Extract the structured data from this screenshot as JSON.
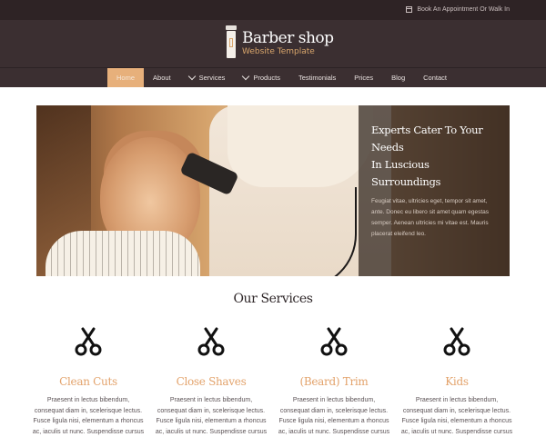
{
  "topbar": {
    "appointment": "Book An Appointment Or Walk In",
    "icon": "calendar-icon"
  },
  "brand": {
    "title": "Barber shop",
    "subtitle": "Website Template",
    "icon": "razor-logo-icon",
    "accent": "#d9a66c"
  },
  "nav": {
    "items": [
      {
        "label": "Home",
        "active": true
      },
      {
        "label": "About"
      },
      {
        "label": "Services",
        "dropdown": true
      },
      {
        "label": "Products",
        "dropdown": true
      },
      {
        "label": "Testimonials"
      },
      {
        "label": "Prices"
      },
      {
        "label": "Blog"
      },
      {
        "label": "Contact"
      }
    ],
    "active_color": "#e7b07b"
  },
  "hero": {
    "heading_line1": "Experts Cater To Your Needs",
    "heading_line2": "In Luscious Surroundings",
    "text": "Feugiat vitae, ultricies eget, tempor sit amet, ante. Donec eu libero sit amet quam egestas semper. Aenean ultricies mi vitae est. Mauris placerat eleifend leo."
  },
  "services": {
    "title": "Our Services",
    "items": [
      {
        "name": "Clean Cuts",
        "desc": "Praesent in lectus bibendum, consequat diam in, scelerisque lectus. Fusce ligula nisi, elementum a rhoncus ac, iaculis ut nunc. Suspendisse cursus",
        "icon": "scissors-icon"
      },
      {
        "name": "Close Shaves",
        "desc": "Praesent in lectus bibendum, consequat diam in, scelerisque lectus. Fusce ligula nisi, elementum a rhoncus ac, iaculis ut nunc. Suspendisse cursus",
        "icon": "scissors-icon"
      },
      {
        "name": "(Beard) Trim",
        "desc": "Praesent in lectus bibendum, consequat diam in, scelerisque lectus. Fusce ligula nisi, elementum a rhoncus ac, iaculis ut nunc. Suspendisse cursus",
        "icon": "scissors-icon"
      },
      {
        "name": "Kids",
        "desc": "Praesent in lectus bibendum, consequat diam in, scelerisque lectus. Fusce ligula nisi, elementum a rhoncus ac, iaculis ut nunc. Suspendisse cursus",
        "icon": "scissors-icon"
      }
    ]
  }
}
